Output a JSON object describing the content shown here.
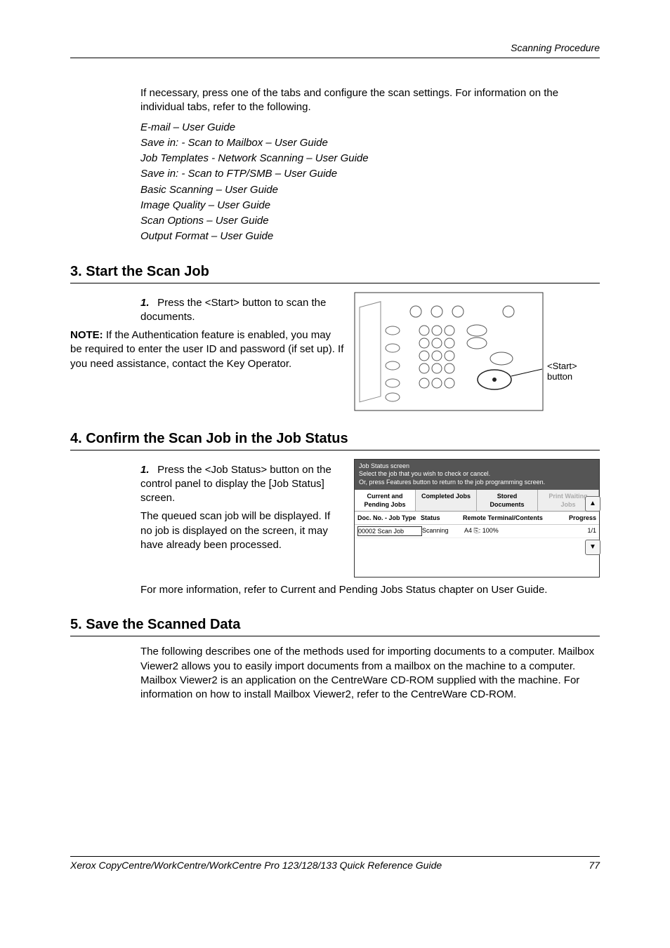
{
  "header": {
    "section_title": "Scanning Procedure"
  },
  "intro": {
    "para": "If necessary, press one of the tabs and configure the scan settings. For information on the individual tabs, refer to the following.",
    "refs": [
      "E-mail – User Guide",
      "Save in: - Scan to Mailbox – User Guide",
      "Job Templates - Network Scanning – User Guide",
      "Save in: - Scan to FTP/SMB – User Guide",
      "Basic Scanning – User Guide",
      "Image Quality – User Guide",
      "Scan Options – User Guide",
      "Output Format – User Guide"
    ]
  },
  "sec3": {
    "title": "3. Start the Scan Job",
    "step_num": "1.",
    "step_text": "Press the <Start> button to scan the documents.",
    "note_label": "NOTE:",
    "note_text": " If the Authentication feature is enabled, you may be required to enter the user ID and password (if set up). If you need assistance, contact the Key Operator.",
    "callout": "<Start>\nbutton"
  },
  "sec4": {
    "title": "4. Confirm the Scan Job in the Job Status",
    "step_num": "1.",
    "step_text": "Press the <Job Status> button on the control panel to display the [Job Status] screen.",
    "para2": "The queued scan job will be displayed. If no job is displayed on the screen, it may have already been processed.",
    "para3": "For more information, refer to Current and Pending Jobs Status chapter on User Guide.",
    "js": {
      "top1": "Job Status screen",
      "top2": "Select the job that you wish to check or cancel.",
      "top3": "Or, press Features button to return to the job programming screen.",
      "tabs": [
        "Current and Pending Jobs",
        "Completed Jobs",
        "Stored Documents",
        "Print Waiting Jobs"
      ],
      "head": [
        "Doc. No. - Job Type",
        "Status",
        "Remote Terminal/Contents",
        "Progress"
      ],
      "row": [
        "00002  Scan Job",
        "Scanning",
        "A4 ⎘: 100%",
        "1/1"
      ]
    }
  },
  "sec5": {
    "title": "5. Save the Scanned Data",
    "para": "The following describes one of the methods used for importing documents to a computer. Mailbox Viewer2 allows you to easily import documents from a mailbox on the machine to a computer. Mailbox Viewer2 is an application on the CentreWare CD-ROM supplied with the machine. For information on how to install Mailbox Viewer2, refer to the CentreWare CD-ROM."
  },
  "footer": {
    "left": "Xerox CopyCentre/WorkCentre/WorkCentre Pro 123/128/133 Quick Reference Guide",
    "right": "77"
  }
}
